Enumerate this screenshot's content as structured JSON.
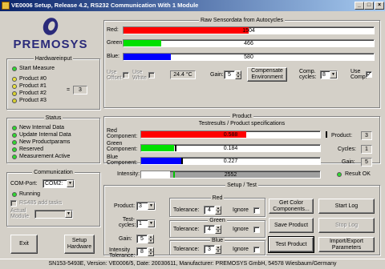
{
  "window": {
    "title": "VE0006 Setup, Release 4.2, RS232 Communication With 1 Module",
    "min": "_",
    "max": "□",
    "close": "×"
  },
  "logo": {
    "text": "PREMOSYS"
  },
  "hardwareinput": {
    "title": "Hardwareinput",
    "start": "Start Measure",
    "product0": "Product #0",
    "product1": "Product #1",
    "product2": "Product #2",
    "product3": "Product #3",
    "eq": "=",
    "value": "3"
  },
  "status": {
    "title": "Status",
    "items": [
      "New Internal Data",
      "Update Internal Data",
      "New Productparams",
      "Reserved",
      "Measurement Active"
    ]
  },
  "communication": {
    "title": "Communication",
    "comport_label": "COM-Port:",
    "comport_value": "COM2:",
    "running": "Running",
    "rs485": "RS485 add tasks",
    "module_label": "Actual Module"
  },
  "buttons": {
    "exit": "Exit",
    "setup": "Setup Hardware",
    "compensate": "Compensate Environment",
    "get_color": "Get Color Components...",
    "start_log": "Start Log",
    "stop_log": "Stop Log",
    "save_product": "Save Product",
    "test_product": "Test Product",
    "import_export": "Import/Export Parameters"
  },
  "raw": {
    "title": "Raw Sensordata from Autocycles",
    "red_label": "Red:",
    "red_value": "1504",
    "green_label": "Green:",
    "green_value": "466",
    "blue_label": "Blue:",
    "blue_value": "580",
    "use_offset": "Use Offset",
    "use_white": "Use White",
    "temp": "24.4 °C",
    "gain_label": "Gain:",
    "gain_value": "5",
    "comp_cycles_label": "Comp. cycles:",
    "comp_cycles_value": "8",
    "use_comp": "Use Comp."
  },
  "product": {
    "title": "Product",
    "subtitle": "Testresults / Product specifications",
    "red_label": "Red Component:",
    "red_value": "0.588",
    "green_label": "Green Component:",
    "green_value": "0.184",
    "blue_label": "Blue Component:",
    "blue_value": "0.227",
    "intensity_label": "Intensity:",
    "intensity_value": "2552",
    "product_label": "Product:",
    "product_value": "3",
    "cycles_label": "Cycles:",
    "cycles_value": "1",
    "gain_label": "Gain:",
    "gain_value": "5",
    "result": "Result OK"
  },
  "setup": {
    "title": "Setup / Test",
    "product_label": "Product:",
    "product_value": "3",
    "test_cycles_label": "Test-cycles:",
    "test_cycles_value": "1",
    "gain_label": "Gain:",
    "gain_value": "5",
    "intensity_label": "Intensity Tolerance:",
    "intensity_value": "8",
    "red": "Red",
    "green": "Green",
    "blue": "Blue",
    "tol_label": "Tolerance:",
    "red_tol": "4",
    "green_tol": "4",
    "blue_tol": "3",
    "ignore": "Ignore"
  },
  "footer": {
    "text": "SN153-5493E, Version: VE0006/5, Date: 20030611, Manufacturer: PREMOSYS GmbH, 54578 Wiesbaum/Germany"
  },
  "colors": {
    "red": "#ff0000",
    "green": "#00e000",
    "blue": "#0000ff",
    "gray": "#a0a0a0"
  },
  "levels": {
    "raw_red": 0.5,
    "raw_green": 0.15,
    "raw_blue": 0.19,
    "prod_red": 0.588,
    "prod_green": 0.184,
    "prod_blue": 0.227,
    "prod_intensity": 0.16
  }
}
